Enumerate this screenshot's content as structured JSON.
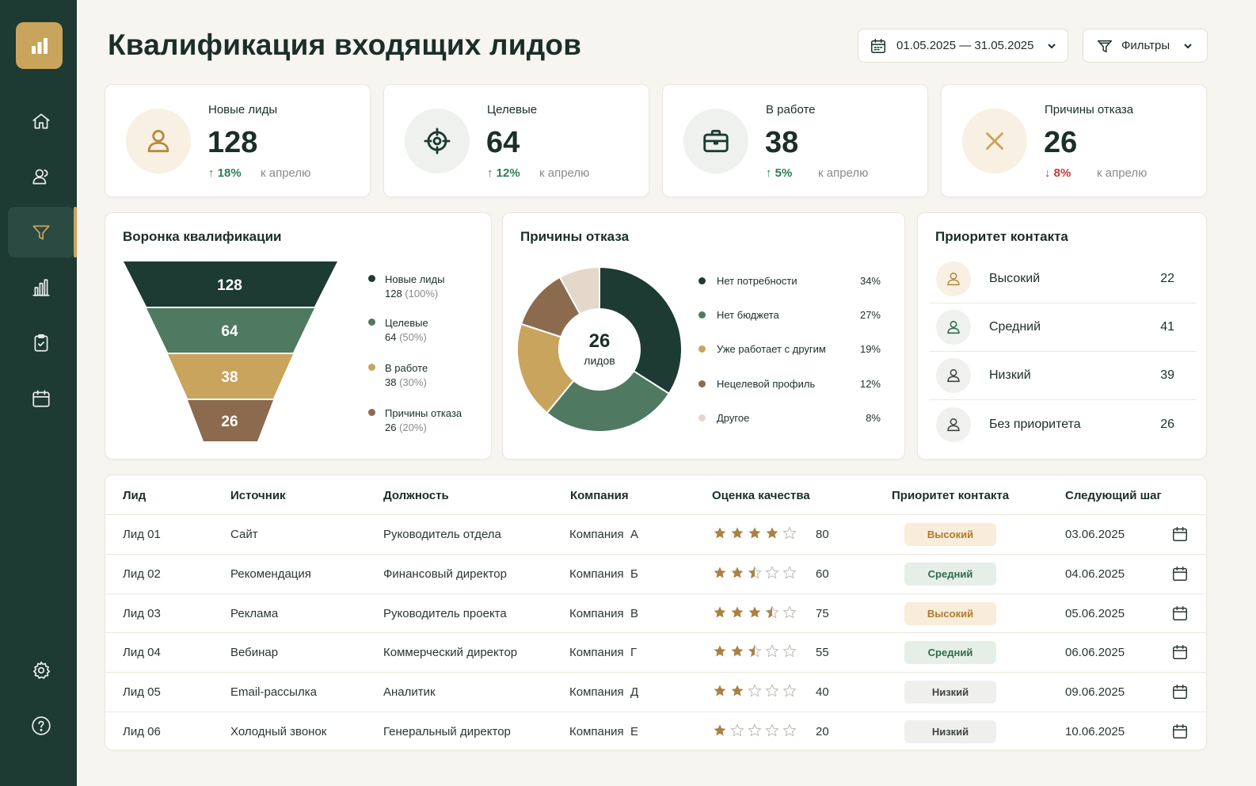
{
  "page": {
    "title": "Квалификация входящих лидов"
  },
  "header": {
    "date_range": "01.05.2025 — 31.05.2025",
    "filters_label": "Фильтры"
  },
  "sidebar": {
    "logo_icon": "bar-chart-icon",
    "items": [
      {
        "id": "home",
        "icon": "home-icon",
        "active": false
      },
      {
        "id": "users",
        "icon": "users-icon",
        "active": false
      },
      {
        "id": "funnel",
        "icon": "funnel-icon",
        "active": true
      },
      {
        "id": "analytics",
        "icon": "bar-chart-icon",
        "active": false
      },
      {
        "id": "tasks",
        "icon": "clipboard-check-icon",
        "active": false
      },
      {
        "id": "calendar",
        "icon": "calendar-icon",
        "active": false
      },
      {
        "id": "settings",
        "icon": "gear-icon",
        "active": false
      },
      {
        "id": "help",
        "icon": "help-icon",
        "active": false
      }
    ]
  },
  "kpis": [
    {
      "label": "Новые лиды",
      "value": "128",
      "delta": "18%",
      "direction": "up",
      "note": "к апрелю",
      "icon": "user-icon"
    },
    {
      "label": "Целевые",
      "value": "64",
      "delta": "12%",
      "direction": "up",
      "note": "к апрелю",
      "icon": "target-icon"
    },
    {
      "label": "В работе",
      "value": "38",
      "delta": "5%",
      "direction": "up",
      "note": "к апрелю",
      "icon": "briefcase-icon"
    },
    {
      "label": "Причины отказа",
      "value": "26",
      "delta": "8%",
      "direction": "down",
      "note": "к апрелю",
      "icon": "x-icon"
    }
  ],
  "funnel": {
    "title": "Воронка квалификации",
    "stages": [
      {
        "value": "128",
        "name": "Новые лиды",
        "count": "128",
        "pct": "(100%)",
        "color": "#1d3a33"
      },
      {
        "value": "64",
        "name": "Целевые",
        "count": "64",
        "pct": "(50%)",
        "color": "#4f7a61"
      },
      {
        "value": "38",
        "name": "В работе",
        "count": "38",
        "pct": "(30%)",
        "color": "#c9a45c"
      },
      {
        "value": "26",
        "name": "Причины отказа",
        "count": "26",
        "pct": "(20%)",
        "color": "#8b6a4e"
      }
    ]
  },
  "reasons": {
    "title": "Причины отказа",
    "center_value": "26",
    "center_label": "лидов"
  },
  "chart_data": {
    "type": "pie",
    "categories": [
      "Нет потребности",
      "Нет бюджета",
      "Уже работает с другим",
      "Нецелевой профиль",
      "Другое"
    ],
    "values": [
      34,
      27,
      19,
      12,
      8
    ],
    "labels": [
      "34%",
      "27%",
      "19%",
      "12%",
      "8%"
    ],
    "colors": [
      "#1d3a33",
      "#4f7a61",
      "#c9a45c",
      "#8b6a4e",
      "#e3d8ca"
    ],
    "title": "Причины отказа"
  },
  "priority": {
    "title": "Приоритет контакта",
    "items": [
      {
        "name": "Высокий",
        "count": "22",
        "tone": "gold"
      },
      {
        "name": "Средний",
        "count": "41",
        "tone": "green"
      },
      {
        "name": "Низкий",
        "count": "39",
        "tone": "gray"
      },
      {
        "name": "Без приоритета",
        "count": "26",
        "tone": "gray"
      }
    ]
  },
  "table": {
    "headers": [
      "Лид",
      "Источник",
      "Должность",
      "Компания",
      "Оценка качества",
      "Приоритет контакта",
      "Следующий шаг"
    ],
    "rows": [
      {
        "lead": "Лид 01",
        "source": "Сайт",
        "position": "Руководитель отдела",
        "company": "Компания  А",
        "rating": 4,
        "score": "80",
        "priority": "Высокий",
        "tier": "high",
        "next": "03.06.2025"
      },
      {
        "lead": "Лид 02",
        "source": "Рекомендация",
        "position": "Финансовый директор",
        "company": "Компания  Б",
        "rating": 2.5,
        "score": "60",
        "priority": "Средний",
        "tier": "mid",
        "next": "04.06.2025"
      },
      {
        "lead": "Лид 03",
        "source": "Реклама",
        "position": "Руководитель проекта",
        "company": "Компания  В",
        "rating": 3.5,
        "score": "75",
        "priority": "Высокий",
        "tier": "high",
        "next": "05.06.2025"
      },
      {
        "lead": "Лид 04",
        "source": "Вебинар",
        "position": "Коммерческий директор",
        "company": "Компания  Г",
        "rating": 2.5,
        "score": "55",
        "priority": "Средний",
        "tier": "mid",
        "next": "06.06.2025"
      },
      {
        "lead": "Лид 05",
        "source": "Email-рассылка",
        "position": "Аналитик",
        "company": "Компания  Д",
        "rating": 2,
        "score": "40",
        "priority": "Низкий",
        "tier": "low",
        "next": "09.06.2025"
      },
      {
        "lead": "Лид 06",
        "source": "Холодный звонок",
        "position": "Генеральный директор",
        "company": "Компания  Е",
        "rating": 1,
        "score": "20",
        "priority": "Низкий",
        "tier": "low",
        "next": "10.06.2025"
      }
    ]
  }
}
